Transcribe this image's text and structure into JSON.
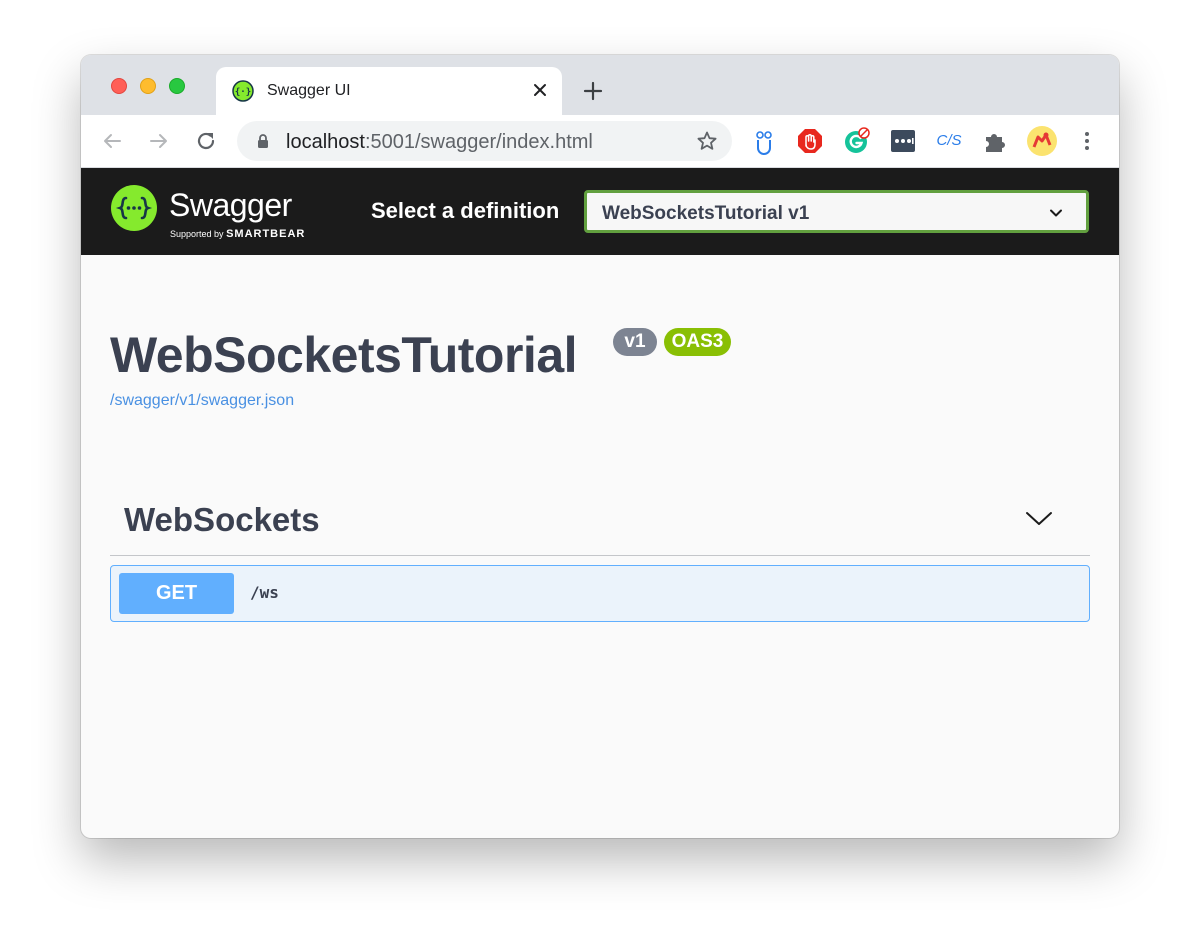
{
  "browser": {
    "tab": {
      "title": "Swagger UI",
      "favicon": "swagger-logo-icon"
    },
    "url": {
      "host": "localhost",
      "rest": ":5001/swagger/index.html"
    },
    "extensions": [
      "owl-extension-icon",
      "adblock-icon",
      "grammarly-icon",
      "password-manager-icon",
      "cjs-extension-icon",
      "puzzle-icon",
      "profile-avatar",
      "more-vert-icon"
    ],
    "ext_cjs_label": "C/S"
  },
  "topbar": {
    "logo_text": "Swagger",
    "logo_sub_prefix": "Supported by",
    "logo_sub_brand": "SMARTBEAR",
    "select_label": "Select a definition",
    "selected_definition": "WebSocketsTutorial v1",
    "accent_color": "#62a03f"
  },
  "info": {
    "title": "WebSocketsTutorial",
    "version_badge": "v1",
    "spec_badge": "OAS3",
    "spec_link": "/swagger/v1/swagger.json"
  },
  "tags": [
    {
      "name": "WebSockets",
      "expanded": true,
      "operations": [
        {
          "method": "GET",
          "path": "/ws",
          "color": "#61affe"
        }
      ]
    }
  ]
}
